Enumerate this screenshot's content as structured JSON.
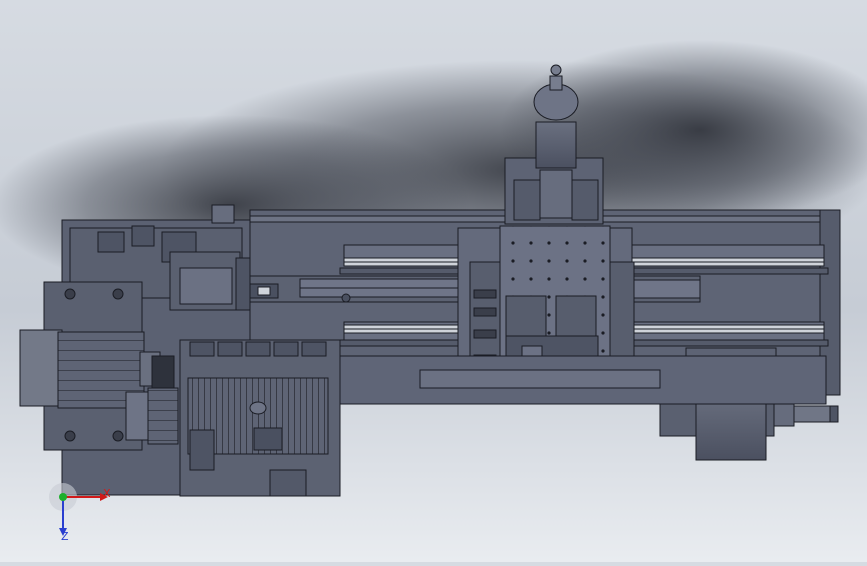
{
  "viewport": {
    "background_top": "#d6dbe2",
    "background_bottom": "#e9ecf0",
    "model_color": "#5f6577",
    "edge_color": "#1a1c24",
    "highlight_color": "#8a90a0"
  },
  "axis_triad": {
    "x_label": "X",
    "z_label": "Z",
    "x_color": "#d11a1a",
    "y_color": "#1db02c",
    "z_color": "#2a3fd0"
  }
}
